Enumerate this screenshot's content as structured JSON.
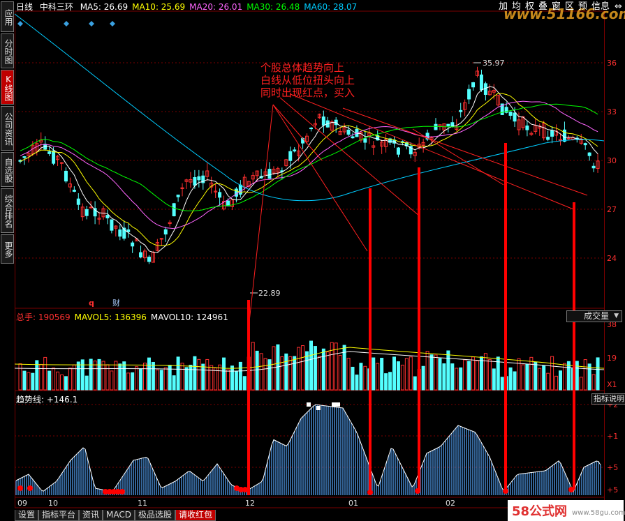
{
  "sidebar": {
    "tabs": [
      {
        "label": "应用",
        "name": "side-tab-apps"
      },
      {
        "label": "分时图",
        "name": "side-tab-intraday"
      },
      {
        "label": "K线图",
        "name": "side-tab-kline"
      },
      {
        "label": "公司资讯",
        "name": "side-tab-company-info"
      },
      {
        "label": "自选股",
        "name": "side-tab-watchlist"
      },
      {
        "label": "综合排名",
        "name": "side-tab-ranking"
      },
      {
        "label": "更多",
        "name": "side-tab-more"
      }
    ],
    "active": 2
  },
  "header": {
    "period": "日线",
    "stock": "中科三环",
    "ma": [
      {
        "label": "MA5: 26.69",
        "color": "#ffffff"
      },
      {
        "label": "MA10: 25.69",
        "color": "#ffff00"
      },
      {
        "label": "MA20: 26.01",
        "color": "#ff66ff"
      },
      {
        "label": "MA30: 26.48",
        "color": "#00ff00"
      },
      {
        "label": "MA60: 28.07",
        "color": "#00ccff"
      }
    ]
  },
  "toolbar": {
    "buttons": [
      "加",
      "均",
      "权",
      "叠",
      "窗",
      "区",
      "预",
      "信息"
    ],
    "arrows_icon": "left-right-arrow-icon"
  },
  "top_watermark": "www.51166.com",
  "price_axis": [
    "36",
    "33",
    "30",
    "27",
    "24"
  ],
  "annotation": {
    "lines": [
      "个股总体趋势向上",
      "白线从低位扭头向上",
      "同时出现红点，买入"
    ]
  },
  "price_marks": {
    "high": "35.97",
    "low": "22.89"
  },
  "markers": {
    "q": "q",
    "cai": "财"
  },
  "volume": {
    "legend": [
      {
        "label": "总手: 190569",
        "color": "#ff3030"
      },
      {
        "label": "MAVOL5: 136396",
        "color": "#ffff00"
      },
      {
        "label": "MAVOL10: 124961",
        "color": "#ffffff"
      }
    ],
    "select_value": "成交量",
    "axis": [
      "38",
      "19",
      "X1"
    ]
  },
  "indicator": {
    "legend": "趋势线: +146.1",
    "help_label": "指标说明",
    "axis": [
      "+2",
      "+1",
      "+5",
      "+5"
    ]
  },
  "date_axis": [
    "09",
    "10",
    "11",
    "12",
    "01",
    "02"
  ],
  "bottom_tabs": [
    "设置",
    "指标平台",
    "资讯",
    "MACD",
    "极品选股",
    "请收红包"
  ],
  "active_bottom_tab": 5,
  "watermark": {
    "logo": "58公式网",
    "url": "www.58gu.com"
  },
  "colors": {
    "up": "#ff3030",
    "down": "#54ffff",
    "ma5": "#ffffff",
    "ma10": "#ffff00",
    "ma20": "#ff66ff",
    "ma30": "#00ff00",
    "ma60": "#00ccff",
    "grid": "#7a0000",
    "indicator_bar": "#4a8fd8",
    "red_signal": "#ff0000"
  }
}
